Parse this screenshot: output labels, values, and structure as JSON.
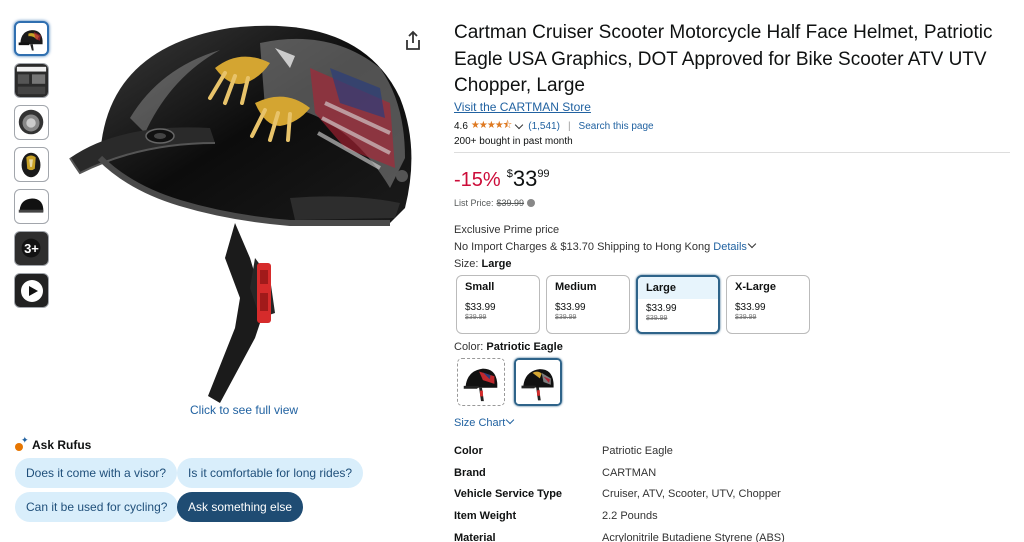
{
  "product": {
    "title": "Cartman Cruiser Scooter Motorcycle Half Face Helmet, Patriotic Eagle USA Graphics, DOT Approved for Bike Scooter ATV UTV Chopper, Large",
    "store_link": "Visit the CARTMAN Store",
    "rating": "4.6",
    "stars": "★★★★⯪",
    "review_count": "(1,541)",
    "search_page": "Search this page",
    "bought": "200+ bought in past month"
  },
  "price": {
    "discount": "-15%",
    "currency": "$",
    "whole": "33",
    "fraction": "99",
    "list_label": "List Price:",
    "list_value": "$39.99"
  },
  "shipping": {
    "prime": "Exclusive Prime price",
    "text": "No Import Charges & $13.70 Shipping to Hong Kong",
    "details": "Details"
  },
  "size": {
    "label": "Size:",
    "selected": "Large",
    "options": [
      {
        "name": "Small",
        "price": "$33.99",
        "list": "$39.99"
      },
      {
        "name": "Medium",
        "price": "$33.99",
        "list": "$39.99"
      },
      {
        "name": "Large",
        "price": "$33.99",
        "list": "$39.99"
      },
      {
        "name": "X-Large",
        "price": "$33.99",
        "list": "$39.99"
      }
    ]
  },
  "color": {
    "label": "Color:",
    "selected": "Patriotic Eagle"
  },
  "size_chart": "Size Chart",
  "specs": [
    {
      "key": "Color",
      "value": "Patriotic Eagle"
    },
    {
      "key": "Brand",
      "value": "CARTMAN"
    },
    {
      "key": "Vehicle Service Type",
      "value": "Cruiser, ATV, Scooter, UTV, Chopper"
    },
    {
      "key": "Item Weight",
      "value": "2.2 Pounds"
    },
    {
      "key": "Material",
      "value": "Acrylonitrile Butadiene Styrene (ABS)"
    }
  ],
  "gallery": {
    "full_view": "Click to see full view",
    "more_count": "3+"
  },
  "rufus": {
    "heading": "Ask Rufus",
    "questions": [
      "Does it come with a visor?",
      "Is it comfortable for long rides?",
      "Can it be used for cycling?",
      "Ask something else"
    ]
  },
  "colors": {
    "link": "#2162a1",
    "discount": "#cc0c39",
    "star": "#de7921",
    "selected_border": "#2e6389"
  }
}
